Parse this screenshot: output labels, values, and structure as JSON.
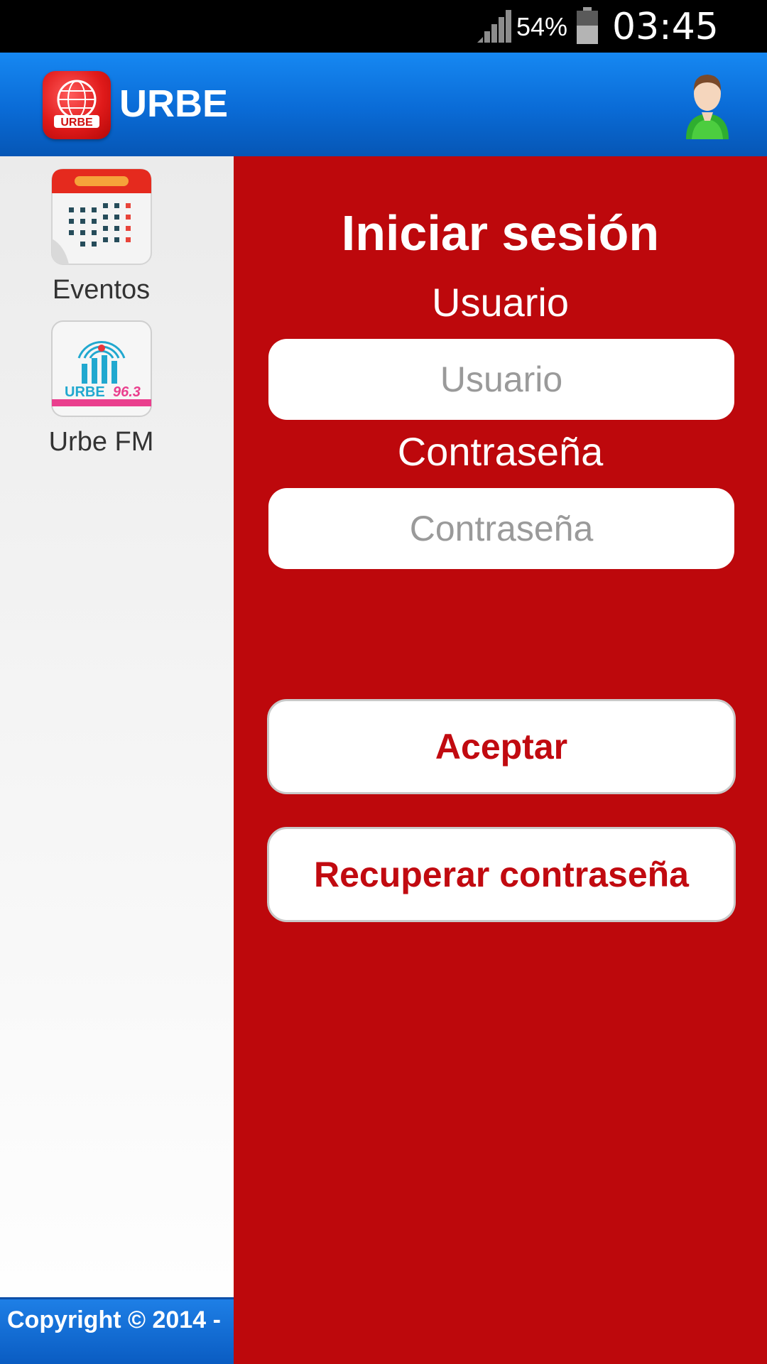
{
  "status_bar": {
    "battery_percent": "54%",
    "time": "03:45 PM",
    "icons": [
      "signal-icon",
      "battery-icon"
    ]
  },
  "app_bar": {
    "title": "URBE",
    "logo_icon": "urbe-logo-icon",
    "profile_icon": "user-profile-icon"
  },
  "sidebar": {
    "items": [
      {
        "label": "Eventos",
        "icon": "calendar-icon"
      },
      {
        "label": "Urbe FM",
        "icon": "urbe-fm-radio-icon"
      }
    ],
    "copyright": "Copyright © 2014 -"
  },
  "login": {
    "title": "Iniciar sesión",
    "username_label": "Usuario",
    "username_placeholder": "Usuario",
    "username_value": "",
    "password_label": "Contraseña",
    "password_placeholder": "Contraseña",
    "password_value": "",
    "accept_label": "Aceptar",
    "recover_label": "Recuperar contraseña"
  },
  "colors": {
    "app_bar_blue": "#0a6bd6",
    "panel_red": "#bd080c",
    "button_text_red": "#c10a10",
    "sidebar_bg": "#f2f2f2"
  }
}
